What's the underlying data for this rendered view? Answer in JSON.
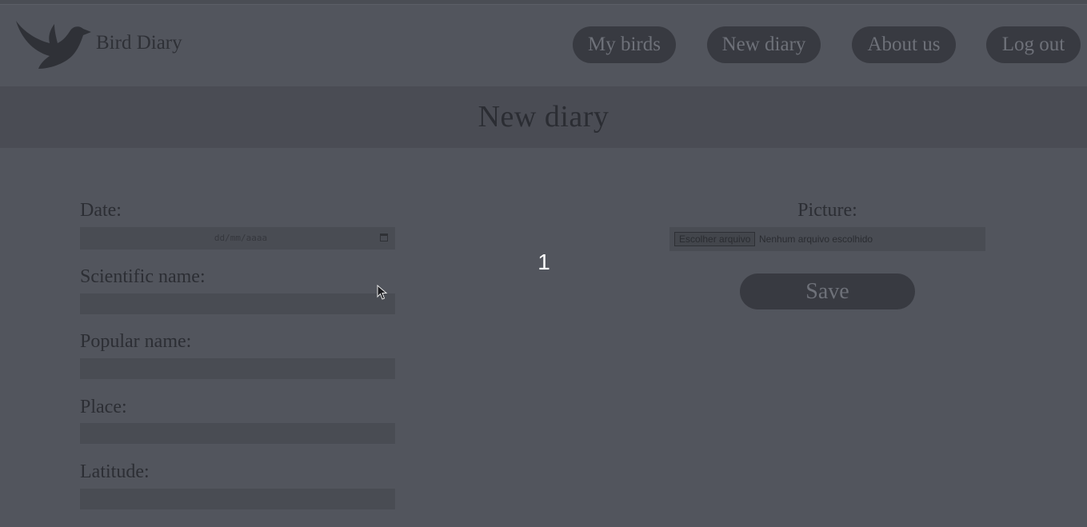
{
  "brand": {
    "name": "Bird Diary",
    "logo_icon": "bird-logo-icon"
  },
  "nav": {
    "items": [
      {
        "label": "My birds"
      },
      {
        "label": "New diary"
      },
      {
        "label": "About us"
      },
      {
        "label": "Log out"
      }
    ]
  },
  "page": {
    "title": "New diary"
  },
  "form": {
    "date_label": "Date:",
    "date_placeholder": "dd/mm/aaaa",
    "scientific_name_label": "Scientific name:",
    "scientific_name_value": "",
    "popular_name_label": "Popular name:",
    "popular_name_value": "",
    "place_label": "Place:",
    "place_value": "",
    "latitude_label": "Latitude:",
    "latitude_value": "",
    "picture_label": "Picture:",
    "file_button_label": "Escolher arquivo",
    "file_status": "Nenhum arquivo escolhido",
    "save_label": "Save"
  },
  "overlay": {
    "step_number": "1"
  },
  "colors": {
    "background": "#52555d",
    "banner": "#4a4c54",
    "button": "#383a41",
    "field": "#494c53"
  }
}
